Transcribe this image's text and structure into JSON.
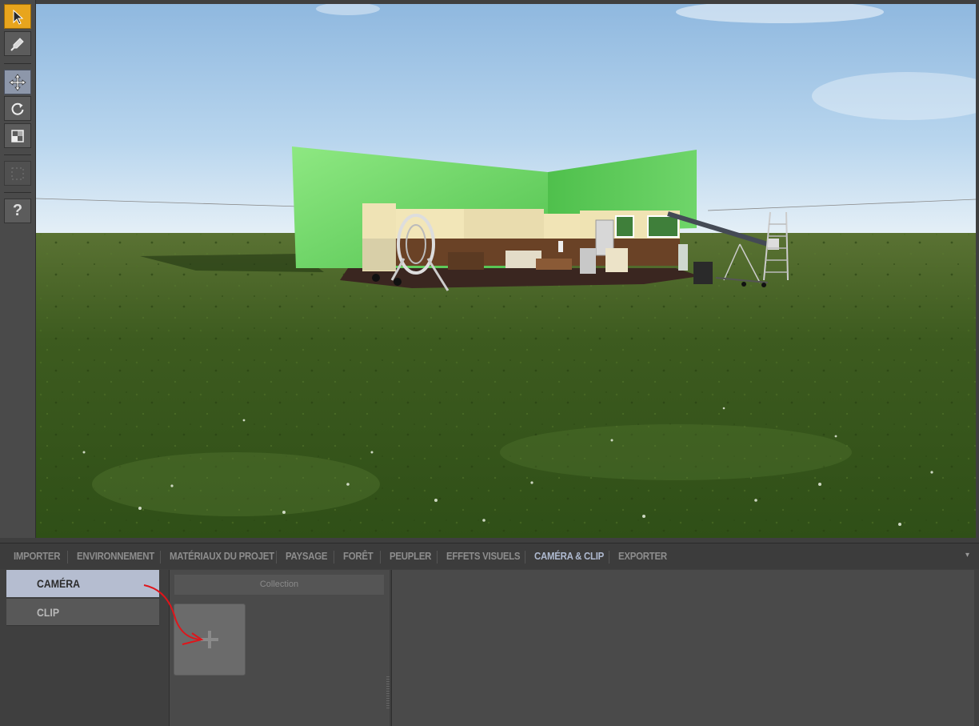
{
  "toolbar": {
    "tools": [
      {
        "name": "select-tool",
        "icon": "arrow-cursor-icon",
        "state": "active"
      },
      {
        "name": "paint-tool",
        "icon": "paint-dropper-icon"
      },
      {
        "name": "move-tool",
        "icon": "move-arrows-icon",
        "state": "active"
      },
      {
        "name": "rotate-tool",
        "icon": "rotate-icon"
      },
      {
        "name": "scale-tool",
        "icon": "scale-square-icon"
      },
      {
        "name": "snap-tool",
        "icon": "dotted-frame-icon",
        "state": "disabled"
      },
      {
        "name": "help-tool",
        "icon": "question-mark-icon",
        "label": "?"
      }
    ]
  },
  "viewport": {
    "scene": "green-screen-film-set-on-grass",
    "sky_color": "#b7d6ee",
    "grass_color": "#3c5d1c",
    "greenscreen_color": "#63cf5f"
  },
  "tabs": [
    {
      "label": "IMPORTER"
    },
    {
      "label": "ENVIRONNEMENT"
    },
    {
      "label": "MATÉRIAUX DU PROJET"
    },
    {
      "label": "PAYSAGE"
    },
    {
      "label": "FORÊT"
    },
    {
      "label": "PEUPLER"
    },
    {
      "label": "EFFETS VISUELS"
    },
    {
      "label": "CAMÉRA & CLIP",
      "active": true
    },
    {
      "label": "EXPORTER"
    }
  ],
  "side_menu": {
    "camera_label": "CAMÉRA",
    "clip_label": "CLIP"
  },
  "collection": {
    "header": "Collection",
    "add_icon": "plus-icon"
  },
  "colors": {
    "accent_select": "#e8a51d",
    "accent_tab": "#aeb9cf",
    "annotation_arrow": "#e0141a"
  }
}
